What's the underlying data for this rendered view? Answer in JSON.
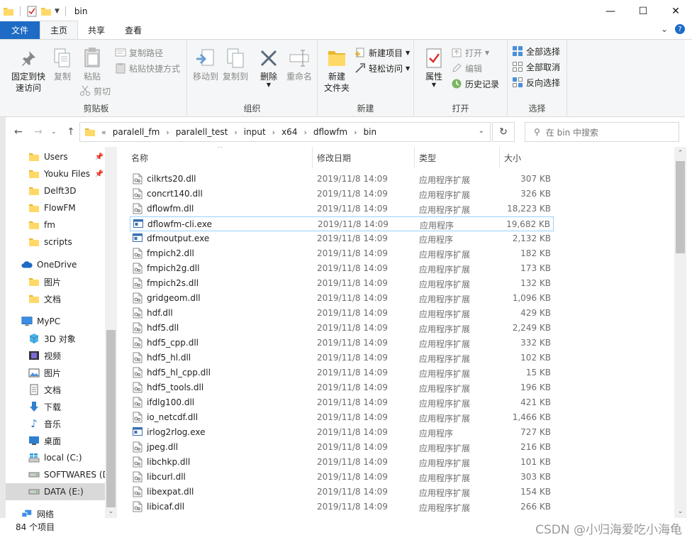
{
  "window": {
    "title": "bin",
    "controls": {
      "minimize": "—",
      "maximize": "☐",
      "close": "✕"
    }
  },
  "tabs": {
    "file": "文件",
    "home": "主页",
    "share": "共享",
    "view": "查看"
  },
  "ribbon": {
    "clipboard": {
      "label": "剪贴板",
      "pin_quick_access": [
        "固定到快",
        "速访问"
      ],
      "copy": "复制",
      "paste": "粘贴",
      "copy_path": "复制路径",
      "paste_shortcut": "粘贴快捷方式",
      "cut": "剪切"
    },
    "organize": {
      "label": "组织",
      "move_to": "移动到",
      "copy_to": "复制到",
      "delete": "删除",
      "rename": "重命名"
    },
    "new": {
      "label": "新建",
      "new_folder": [
        "新建",
        "文件夹"
      ],
      "new_item": "新建项目",
      "easy_access": "轻松访问"
    },
    "open": {
      "label": "打开",
      "properties": "属性",
      "open": "打开",
      "edit": "编辑",
      "history": "历史记录"
    },
    "select": {
      "label": "选择",
      "select_all": "全部选择",
      "select_none": "全部取消",
      "invert": "反向选择"
    }
  },
  "address": {
    "prefix": "«",
    "crumbs": [
      "paralell_fm",
      "paralell_test",
      "input",
      "x64",
      "dflowfm",
      "bin"
    ],
    "search_placeholder": "在 bin 中搜索"
  },
  "nav": {
    "quick": [
      "Users",
      "Youku Files",
      "Delft3D",
      "FlowFM",
      "fm",
      "scripts"
    ],
    "onedrive": "OneDrive",
    "onedrive_items": [
      "图片",
      "文档"
    ],
    "mypc": "MyPC",
    "pc_items": [
      "3D 对象",
      "视频",
      "图片",
      "文档",
      "下载",
      "音乐",
      "桌面",
      "local (C:)",
      "SOFTWARES (D",
      "DATA (E:)"
    ],
    "network": "网络"
  },
  "columns": {
    "name": "名称",
    "date": "修改日期",
    "type": "类型",
    "size": "大小"
  },
  "files": [
    {
      "name": "cilkrts20.dll",
      "date": "2019/11/8 14:09",
      "type": "应用程序扩展",
      "size": "307 KB",
      "kind": "dll"
    },
    {
      "name": "concrt140.dll",
      "date": "2019/11/8 14:09",
      "type": "应用程序扩展",
      "size": "326 KB",
      "kind": "dll"
    },
    {
      "name": "dflowfm.dll",
      "date": "2019/11/8 14:09",
      "type": "应用程序扩展",
      "size": "18,223 KB",
      "kind": "dll"
    },
    {
      "name": "dflowfm-cli.exe",
      "date": "2019/11/8 14:09",
      "type": "应用程序",
      "size": "19,682 KB",
      "kind": "exe"
    },
    {
      "name": "dfmoutput.exe",
      "date": "2019/11/8 14:09",
      "type": "应用程序",
      "size": "2,132 KB",
      "kind": "exe"
    },
    {
      "name": "fmpich2.dll",
      "date": "2019/11/8 14:09",
      "type": "应用程序扩展",
      "size": "182 KB",
      "kind": "dll"
    },
    {
      "name": "fmpich2g.dll",
      "date": "2019/11/8 14:09",
      "type": "应用程序扩展",
      "size": "173 KB",
      "kind": "dll"
    },
    {
      "name": "fmpich2s.dll",
      "date": "2019/11/8 14:09",
      "type": "应用程序扩展",
      "size": "132 KB",
      "kind": "dll"
    },
    {
      "name": "gridgeom.dll",
      "date": "2019/11/8 14:09",
      "type": "应用程序扩展",
      "size": "1,096 KB",
      "kind": "dll"
    },
    {
      "name": "hdf.dll",
      "date": "2019/11/8 14:09",
      "type": "应用程序扩展",
      "size": "429 KB",
      "kind": "dll"
    },
    {
      "name": "hdf5.dll",
      "date": "2019/11/8 14:09",
      "type": "应用程序扩展",
      "size": "2,249 KB",
      "kind": "dll"
    },
    {
      "name": "hdf5_cpp.dll",
      "date": "2019/11/8 14:09",
      "type": "应用程序扩展",
      "size": "332 KB",
      "kind": "dll"
    },
    {
      "name": "hdf5_hl.dll",
      "date": "2019/11/8 14:09",
      "type": "应用程序扩展",
      "size": "102 KB",
      "kind": "dll"
    },
    {
      "name": "hdf5_hl_cpp.dll",
      "date": "2019/11/8 14:09",
      "type": "应用程序扩展",
      "size": "15 KB",
      "kind": "dll"
    },
    {
      "name": "hdf5_tools.dll",
      "date": "2019/11/8 14:09",
      "type": "应用程序扩展",
      "size": "196 KB",
      "kind": "dll"
    },
    {
      "name": "ifdlg100.dll",
      "date": "2019/11/8 14:09",
      "type": "应用程序扩展",
      "size": "421 KB",
      "kind": "dll"
    },
    {
      "name": "io_netcdf.dll",
      "date": "2019/11/8 14:09",
      "type": "应用程序扩展",
      "size": "1,466 KB",
      "kind": "dll"
    },
    {
      "name": "irlog2rlog.exe",
      "date": "2019/11/8 14:09",
      "type": "应用程序",
      "size": "727 KB",
      "kind": "exe"
    },
    {
      "name": "jpeg.dll",
      "date": "2019/11/8 14:09",
      "type": "应用程序扩展",
      "size": "216 KB",
      "kind": "dll"
    },
    {
      "name": "libchkp.dll",
      "date": "2019/11/8 14:09",
      "type": "应用程序扩展",
      "size": "101 KB",
      "kind": "dll"
    },
    {
      "name": "libcurl.dll",
      "date": "2019/11/8 14:09",
      "type": "应用程序扩展",
      "size": "303 KB",
      "kind": "dll"
    },
    {
      "name": "libexpat.dll",
      "date": "2019/11/8 14:09",
      "type": "应用程序扩展",
      "size": "154 KB",
      "kind": "dll"
    },
    {
      "name": "libicaf.dll",
      "date": "2019/11/8 14:09",
      "type": "应用程序扩展",
      "size": "266 KB",
      "kind": "dll"
    }
  ],
  "highlighted_index": 3,
  "status": {
    "count": "84 个项目"
  },
  "watermark": "CSDN @小归海爱吃小海龟",
  "colors": {
    "accent": "#1e6bc5",
    "folder": "#f5c542",
    "selection_border": "#99d1ff"
  }
}
